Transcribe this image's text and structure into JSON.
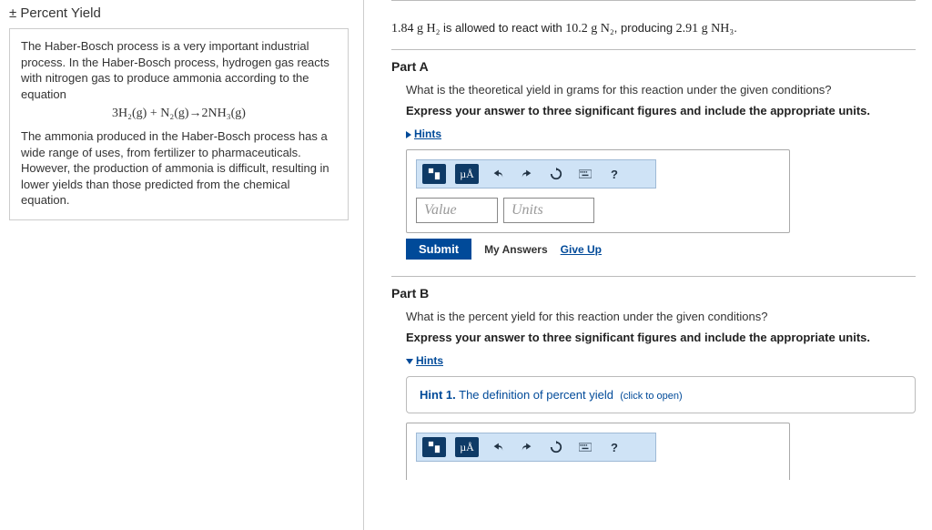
{
  "left": {
    "title": "± Percent Yield",
    "para1": "The Haber-Bosch process is a very important industrial process. In the Haber-Bosch process, hydrogen gas reacts with nitrogen gas to produce ammonia according to the equation",
    "equation": "3H₂(g) + N₂(g)→2NH₃(g)",
    "para2": "The ammonia produced in the Haber-Bosch process has a wide range of uses, from fertilizer to pharmaceuticals. However, the production of ammonia is difficult, resulting in lower yields than those predicted from the chemical equation."
  },
  "given": {
    "m_h2": "1.84",
    "label_h2": "g H₂",
    "mid1": "is allowed to react with",
    "m_n2": "10.2",
    "label_n2": "g N₂",
    "mid2": ", producing",
    "m_nh3": "2.91",
    "label_nh3": "g NH₃",
    "end": "."
  },
  "partA": {
    "title": "Part A",
    "question": "What is the theoretical yield in grams for this reaction under the given conditions?",
    "instruction": "Express your answer to three significant figures and include the appropriate units.",
    "hints_label": "Hints",
    "value_ph": "Value",
    "units_ph": "Units",
    "submit": "Submit",
    "my_answers": "My Answers",
    "give_up": "Give Up"
  },
  "partB": {
    "title": "Part B",
    "question": "What is the percent yield for this reaction under the given conditions?",
    "instruction": "Express your answer to three significant figures and include the appropriate units.",
    "hints_label": "Hints",
    "hint1_prefix": "Hint 1.",
    "hint1_text": "The definition of percent yield",
    "click_open": "(click to open)"
  },
  "toolbar": {
    "mu_label": "µÅ",
    "help": "?"
  }
}
